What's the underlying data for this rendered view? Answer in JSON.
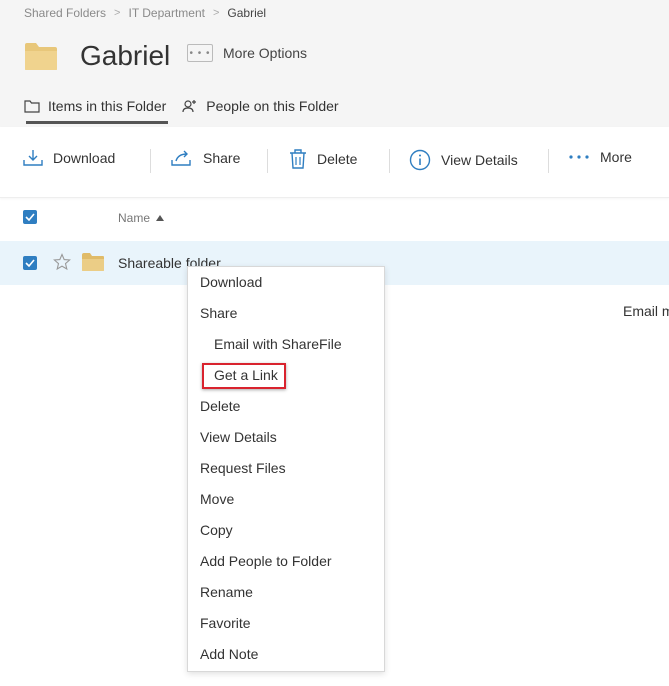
{
  "breadcrumb": {
    "items": [
      "Shared Folders",
      "IT Department",
      "Gabriel"
    ],
    "separator": ">"
  },
  "folder": {
    "title": "Gabriel",
    "more_options": "More Options"
  },
  "tabs": [
    {
      "label": "Items in this Folder",
      "icon": "folder-icon",
      "active": true
    },
    {
      "label": "People on this Folder",
      "icon": "person-add-icon",
      "active": false
    }
  ],
  "toolbar": {
    "download": "Download",
    "share": "Share",
    "delete": "Delete",
    "view_details": "View Details",
    "more": "More"
  },
  "list": {
    "column_name": "Name",
    "sort": "ascending",
    "rows": [
      {
        "name": "Shareable folder",
        "selected": true,
        "favorite": false
      }
    ]
  },
  "partial_text": "Email m",
  "context_menu": {
    "items": [
      {
        "label": "Download",
        "sub": false
      },
      {
        "label": "Share",
        "sub": false
      },
      {
        "label": "Email with ShareFile",
        "sub": true
      },
      {
        "label": "Get a Link",
        "sub": true,
        "highlighted": true
      },
      {
        "label": "Delete",
        "sub": false
      },
      {
        "label": "View Details",
        "sub": false
      },
      {
        "label": "Request Files",
        "sub": false
      },
      {
        "label": "Move",
        "sub": false
      },
      {
        "label": "Copy",
        "sub": false
      },
      {
        "label": "Add People to Folder",
        "sub": false
      },
      {
        "label": "Rename",
        "sub": false
      },
      {
        "label": "Favorite",
        "sub": false
      },
      {
        "label": "Add Note",
        "sub": false
      }
    ]
  },
  "colors": {
    "accent": "#2f7ec1",
    "folder": "#e8c77a",
    "highlight": "#d9232e",
    "selected_row": "#e9f4fb"
  }
}
